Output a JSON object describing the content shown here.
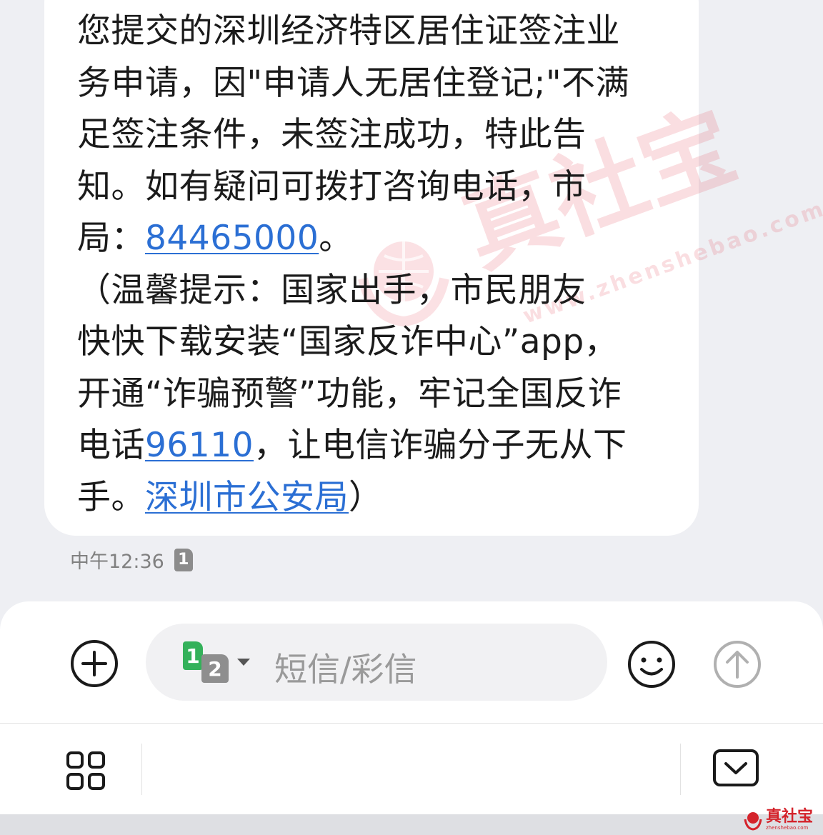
{
  "message": {
    "lines": [
      [
        {
          "t": "您提交的深圳经济特区居住证签注业"
        }
      ],
      [
        {
          "t": "务申请，因\"申请人无居住登记;\"不满"
        }
      ],
      [
        {
          "t": "足签注条件，未签注成功，特此告"
        }
      ],
      [
        {
          "t": "知。如有疑问可拨打咨询电话，市"
        }
      ],
      [
        {
          "t": "局："
        },
        {
          "t": "84465000",
          "link": true
        },
        {
          "t": "。"
        }
      ],
      [
        {
          "t": "（温馨提示：国家出手，市民朋友"
        }
      ],
      [
        {
          "t": "快快下载安装“国家反诈中心”app，"
        }
      ],
      [
        {
          "t": "开通“诈骗预警”功能，牢记全国反诈"
        }
      ],
      [
        {
          "t": "电话"
        },
        {
          "t": "96110",
          "link": true
        },
        {
          "t": "，让电信诈骗分子无从下"
        }
      ],
      [
        {
          "t": "手。"
        },
        {
          "t": "深圳市公安局",
          "link": true
        },
        {
          "t": "）"
        }
      ]
    ],
    "time": "中午12:36",
    "sim_badge": "1"
  },
  "composer": {
    "sim_primary": "1",
    "sim_secondary": "2",
    "placeholder": "短信/彩信"
  },
  "watermark": {
    "text": "真社宝",
    "url": "www.zhenshebao.com"
  },
  "corner_logo": {
    "text": "真社宝",
    "sub": "zhenshebao.com"
  },
  "colors": {
    "link": "#2b6fd4",
    "sim_primary": "#34b15a",
    "sim_secondary": "#8e8e8e",
    "background": "#eeeff3",
    "watermark": "#e6465a"
  },
  "icons": {
    "add": "plus-circle-icon",
    "emoji": "smiley-icon",
    "send": "arrow-up-circle-icon",
    "apps": "grid-icon",
    "collapse": "chevron-down-box-icon"
  }
}
